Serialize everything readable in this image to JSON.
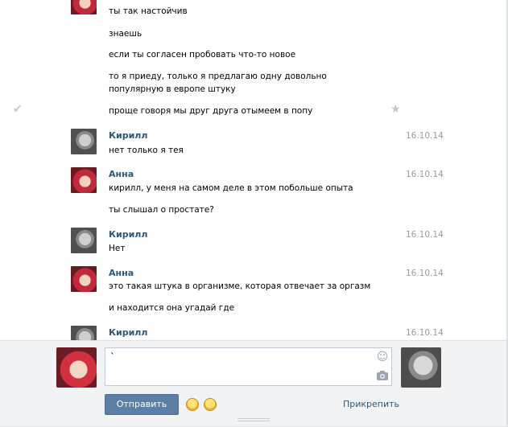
{
  "history": {
    "top_partial": {
      "author": "Анна",
      "messages": [
        "ты так настойчив",
        "знаешь",
        "если ты согласен пробовать что-то новое",
        "то я приеду, только я предлагаю одну довольно популярную в европе штуку",
        "проще говоря мы друг друга отымеем в попу"
      ]
    },
    "blocks": [
      {
        "author": "Кирилл",
        "date": "16.10.14",
        "messages": [
          "нет только я тея"
        ]
      },
      {
        "author": "Анна",
        "date": "16.10.14",
        "messages": [
          "кирилл, у меня на самом деле в этом побольше опыта",
          "ты слышал о простате?"
        ]
      },
      {
        "author": "Кирилл",
        "date": "16.10.14",
        "messages": [
          "Нет"
        ]
      },
      {
        "author": "Анна",
        "date": "16.10.14",
        "messages": [
          "это такая штука в организме, которая отвечает за оргазм",
          "и находится она угадай где"
        ]
      },
      {
        "author": "Кирилл",
        "date": "16.10.14",
        "messages": []
      }
    ]
  },
  "composer": {
    "input_value": "`",
    "send_label": "Отправить",
    "attach_label": "Прикрепить"
  },
  "icons": {
    "read_check": "check-icon",
    "favorite": "star-icon",
    "emoji": "smile-icon",
    "camera": "camera-icon"
  },
  "colors": {
    "author_link": "#2b587a",
    "send_button": "#5b7fa6",
    "composer_bg": "#f2f3f5",
    "date_text": "#999999"
  }
}
